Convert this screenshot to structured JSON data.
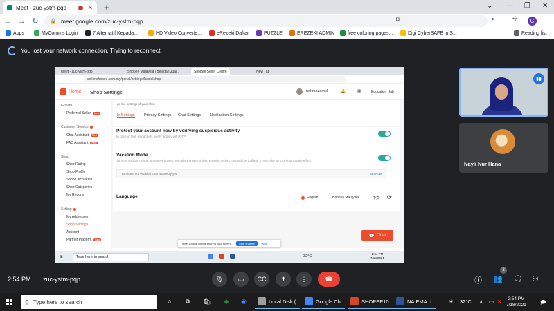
{
  "browser": {
    "tab_title": "Meet - zuc-ystm-pqp",
    "new_tab": "+",
    "url": "meet.google.com/zuc-ystm-pqp",
    "profile_initial": "C",
    "bookmarks": [
      {
        "label": "Apps",
        "color": "#1a73e8"
      },
      {
        "label": "MyComms Login",
        "color": "#34a853"
      },
      {
        "label": "7 Alternatif Kepada...",
        "color": "#202124"
      },
      {
        "label": "HD Video Converte...",
        "color": "#f9ab00"
      },
      {
        "label": "eRezeki Daftar",
        "color": "#d93025"
      },
      {
        "label": "PUZZLE",
        "color": "#673ab7"
      },
      {
        "label": "EREZEKI ADMIN",
        "color": "#e37400"
      },
      {
        "label": "free coloring pages...",
        "color": "#1e8e3e"
      },
      {
        "label": "Digi CyberSAFE in S...",
        "color": "#fbbc04"
      },
      {
        "label": "Reading list",
        "color": "#5f6368"
      }
    ]
  },
  "meet": {
    "banner": "You lost your network connection. Trying to reconnect.",
    "time": "2:54 PM",
    "meeting_code": "zuc-ystm-pqp",
    "participants_count": "3",
    "tiles": [
      {
        "name": ""
      },
      {
        "name": "Nayli Nur Hana"
      }
    ]
  },
  "presentation": {
    "tabs": [
      "Meet - zuc-ystm-pqp",
      "Shopee Malaysia | Beli dan Jual...",
      "Shopee Seller Centre",
      "New Tab"
    ],
    "url": "seller.shopee.com.my/portal/settings/basic/shop",
    "home": "Home",
    "title": "Shop Settings",
    "username": "nokmozamel",
    "education": "Education Hub",
    "sidebar": [
      {
        "type": "section",
        "label": "Growth",
        "dot": false
      },
      {
        "type": "item",
        "label": "Preferred Seller",
        "badge": "New"
      },
      {
        "type": "section",
        "label": "Customer Service",
        "dot": true
      },
      {
        "type": "item",
        "label": "Chat Assistant",
        "badge": "New"
      },
      {
        "type": "item",
        "label": "FAQ Assistant",
        "badge": "New"
      },
      {
        "type": "section",
        "label": "Shop",
        "dot": false
      },
      {
        "type": "item",
        "label": "Shop Rating",
        "badge": ""
      },
      {
        "type": "item",
        "label": "Shop Profile",
        "badge": ""
      },
      {
        "type": "item",
        "label": "Shop Decoration",
        "badge": ""
      },
      {
        "type": "item",
        "label": "Shop Categories",
        "badge": ""
      },
      {
        "type": "item",
        "label": "My Reports",
        "badge": ""
      },
      {
        "type": "section",
        "label": "Setting",
        "dot": true
      },
      {
        "type": "item",
        "label": "My Addresses",
        "badge": ""
      },
      {
        "type": "item",
        "label": "Shop Settings",
        "badge": "",
        "active": true
      },
      {
        "type": "item",
        "label": "Account",
        "badge": ""
      },
      {
        "type": "item",
        "label": "Partner Platform",
        "badge": "New"
      }
    ],
    "content": {
      "intro": "ge the settings of your shop",
      "tabs": [
        "le Settings",
        "Privacy Settings",
        "Chat Settings",
        "Notification Settings"
      ],
      "protect_title": "Protect your account now by verifying suspicious activity",
      "protect_sub": "In case of high risk activity, verify activity with OTP",
      "vacation_title": "Vacation Mode",
      "vacation_sub": "Turn on Vacation Mode to prevent buyers from placing new orders. Existing orders must still be fulfilled. It may take up to 1 hour to take effect.",
      "autoreply_text": "You have not enabled chat autoreply yet.",
      "autoreply_link": "Set Now",
      "language_title": "Language",
      "languages": [
        "English",
        "Bahasa Malaysia",
        "中文"
      ],
      "chat_label": "Chat"
    },
    "sharebar": {
      "text": "meet.google.com is sharing your screen.",
      "stop": "Stop sharing",
      "hide": "Hide"
    },
    "taskbar": {
      "search": "Type here to search",
      "temp": "32°C",
      "time": "2:54 PM",
      "date": "7/18/2021"
    }
  },
  "taskbar": {
    "search_placeholder": "Type here to search",
    "apps": [
      {
        "label": "Local Disk (...",
        "color": "#9e9e9e"
      },
      {
        "label": "Google Ch...",
        "color": "#4285f4"
      },
      {
        "label": "SHOPEE10...",
        "color": "#d24726"
      },
      {
        "label": "NAIEMA.d...",
        "color": "#2b579a"
      }
    ],
    "weather": "32°C",
    "time": "2:54 PM",
    "date": "7/18/2021"
  },
  "colors": {
    "meet_bg": "#202124",
    "end_call": "#ea4335",
    "shopee": "#ee4d2d",
    "toggle_on": "#26aa99"
  }
}
